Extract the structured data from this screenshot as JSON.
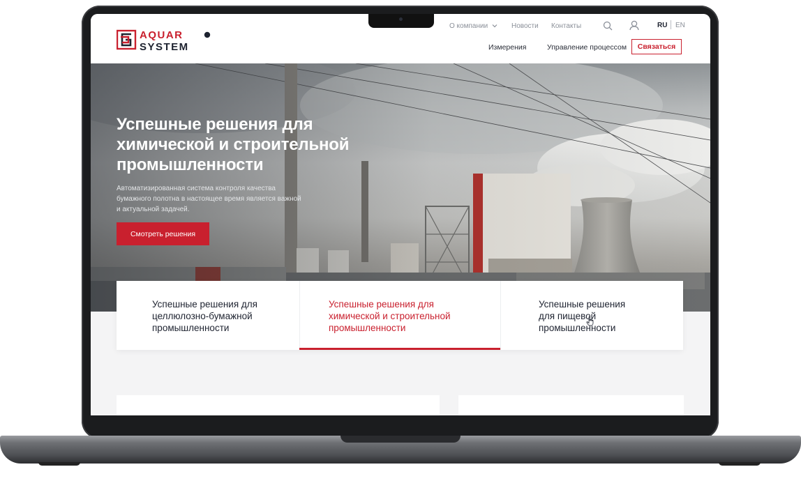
{
  "brand": {
    "name_top": "AQUAR",
    "name_bottom": "SYSTEM",
    "accent": "#c9202e",
    "dark": "#1e2330"
  },
  "top_nav": {
    "about": "О компании",
    "news": "Новости",
    "contacts": "Контакты",
    "lang_ru": "RU",
    "lang_en": "EN"
  },
  "main_nav": {
    "measurements": "Измерения",
    "process": "Управление процессом",
    "contact_button": "Связаться"
  },
  "hero": {
    "title": "Успешные решения для химической и строительной промышленности",
    "subtitle": "Автоматизированная система контроля качества бумажного полотна в настоящее время является важной и актуальной задачей.",
    "button": "Смотреть решения"
  },
  "tabs": [
    {
      "label": "Успешные решения для целлюлозно-бумажной промышленности"
    },
    {
      "label": "Успешные решения для химической и строительной промышленности",
      "active": true
    },
    {
      "label": "Успешные решения для пищевой промышленности"
    }
  ]
}
